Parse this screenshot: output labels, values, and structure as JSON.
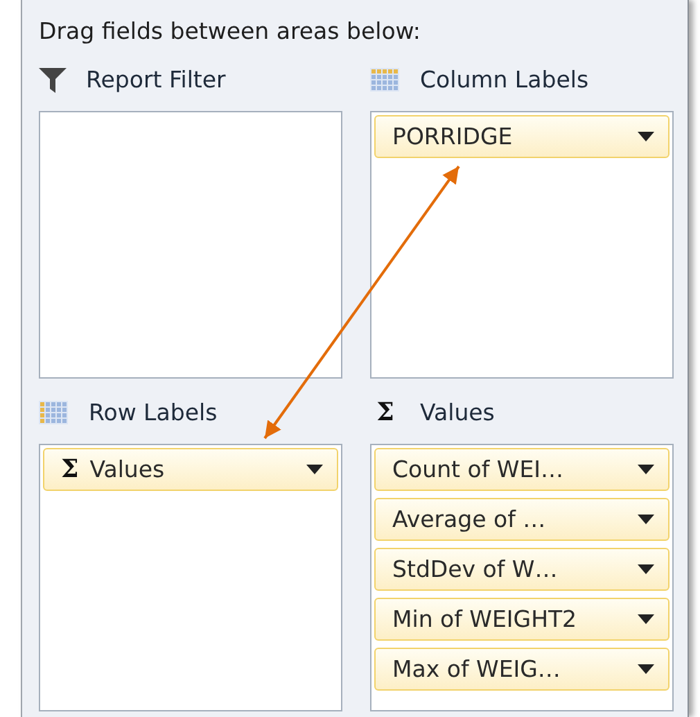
{
  "header": "Drag fields between areas below:",
  "areas": [
    {
      "kind": "filter",
      "label": "Report Filter"
    },
    {
      "kind": "columns",
      "label": "Column Labels",
      "fields": [
        {
          "label": "PORRIDGE"
        }
      ]
    },
    {
      "kind": "rows",
      "label": "Row Labels",
      "fields": [
        {
          "label": "Values",
          "glyph": "Σ"
        }
      ]
    },
    {
      "kind": "values",
      "label": "Values",
      "glyph": "Σ",
      "fields": [
        {
          "label": "Count of WEI…"
        },
        {
          "label": "Average of …"
        },
        {
          "label": "StdDev of W…"
        },
        {
          "label": "Min of WEIGHT2"
        },
        {
          "label": "Max of WEIG…"
        }
      ]
    }
  ]
}
